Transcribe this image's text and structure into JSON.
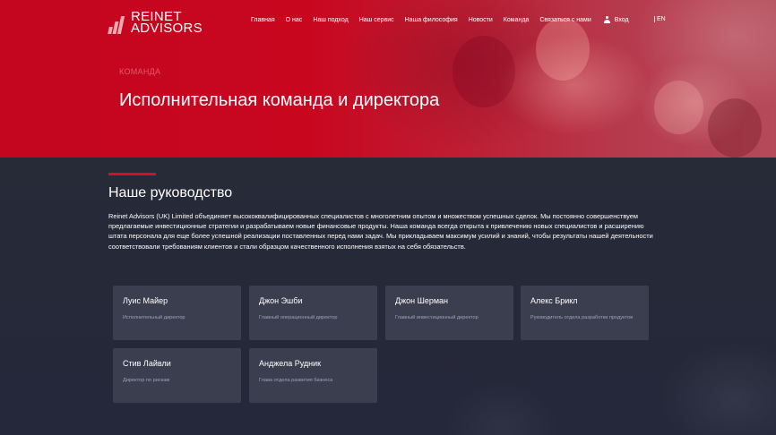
{
  "brand": {
    "line1": "REINET",
    "line2": "ADVISORS"
  },
  "nav": {
    "items": [
      "Главная",
      "О нас",
      "Наш подход",
      "Наш сервис",
      "Наша философия",
      "Новости",
      "Команда",
      "Связаться с нами"
    ],
    "login": "Вход",
    "lang": "EN"
  },
  "hero": {
    "kicker": "КОМАНДА",
    "title": "Исполнительная команда и директора"
  },
  "section": {
    "title": "Наше руководство",
    "text": "Reinet Advisors (UK) Limited объединяет высококвалифицированных специалистов с многолетним опытом и множеством успешных сделок. Мы постоянно совершенствуем предлагаемые инвестиционные стратегии и разрабатываем новые финансовые продукты. Наша команда всегда открыта к привлечению новых специалистов и расширению штата персонала для еще более успешной реализации поставленных перед нами задач. Мы прикладываем максимум усилий и знаний, чтобы результаты нашей деятельности соответствовали требованиям клиентов и стали образцом качественного исполнения взятых на себя обязательств."
  },
  "team": [
    {
      "name": "Луис Майер",
      "role": "Исполнительный директор"
    },
    {
      "name": "Джон Эшби",
      "role": "Главный операционный директор"
    },
    {
      "name": "Джон Шерман",
      "role": "Главный инвестиционный директор"
    },
    {
      "name": "Алекс Брикл",
      "role": "Руководитель отдела разработки продуктов"
    },
    {
      "name": "Стив Лайвли",
      "role": "Директор по рискам"
    },
    {
      "name": "Анджела Рудник",
      "role": "Глава отдела развития бизнеса"
    }
  ],
  "colors": {
    "accent": "#d50f2a",
    "hero": "#c4061f",
    "background": "#262836",
    "card": "#3b3e4f"
  }
}
